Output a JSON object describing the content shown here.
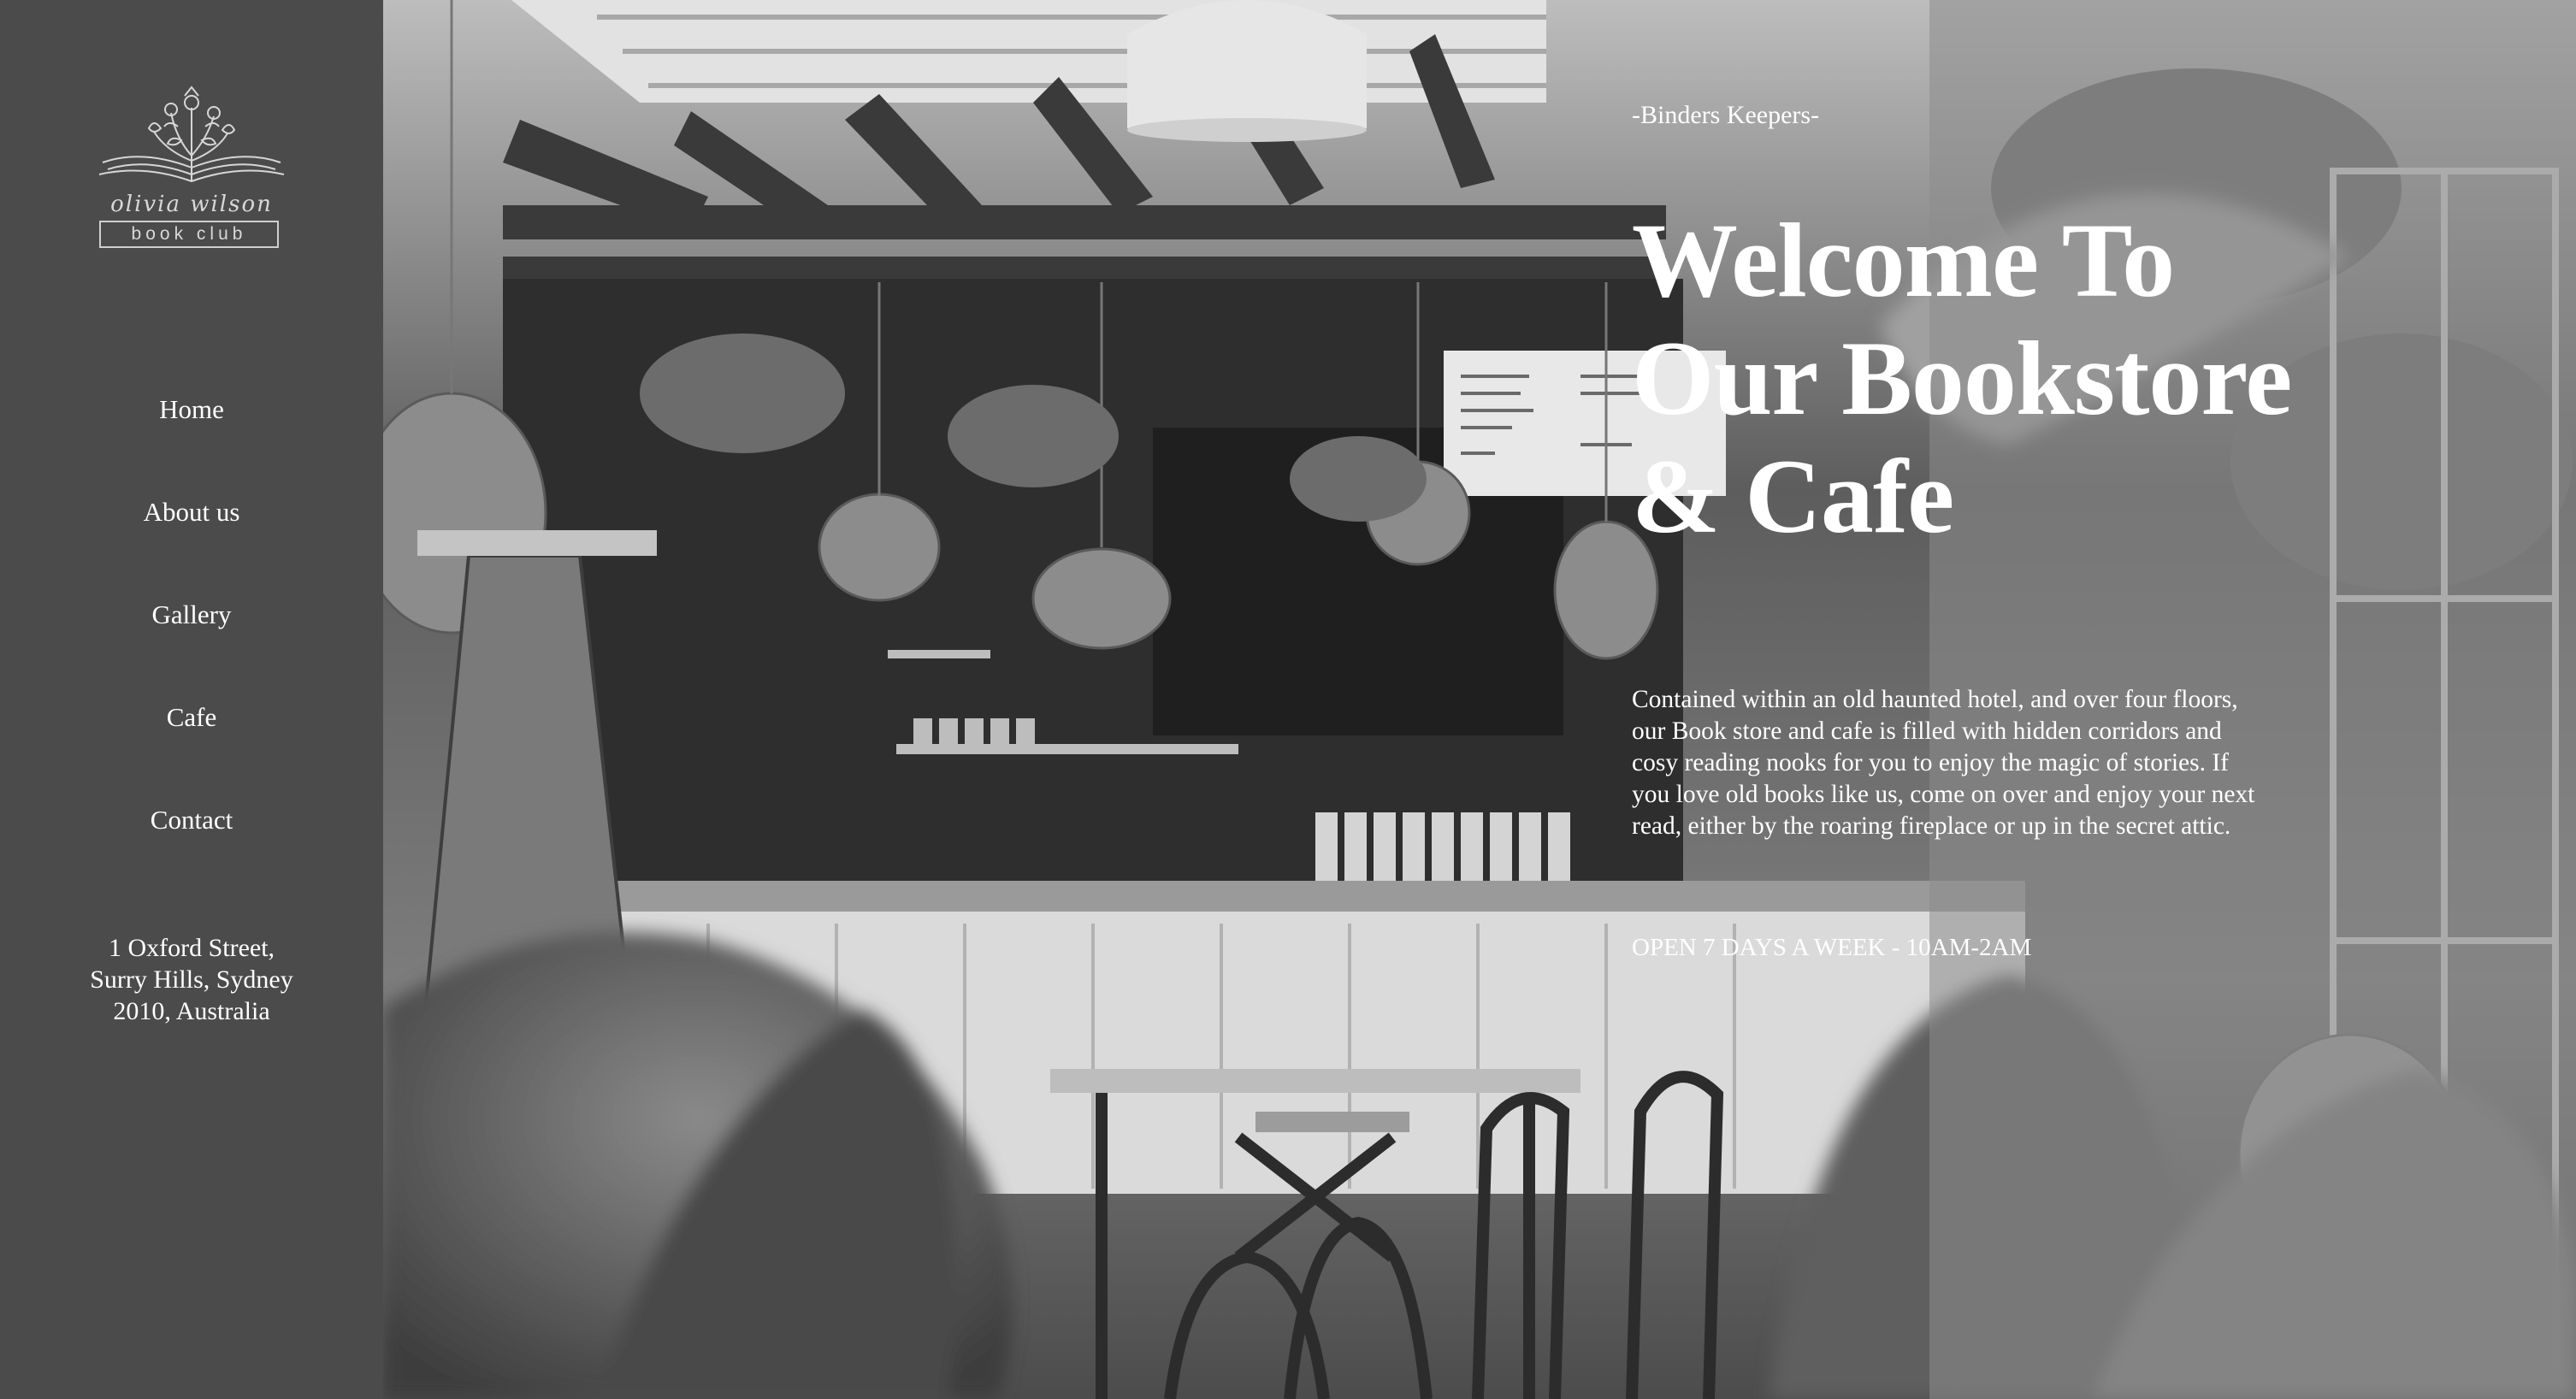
{
  "brand": {
    "name": "olivia wilson",
    "subtitle": "book club"
  },
  "nav": {
    "items": [
      {
        "label": "Home"
      },
      {
        "label": "About us"
      },
      {
        "label": "Gallery"
      },
      {
        "label": "Cafe"
      },
      {
        "label": "Contact"
      }
    ]
  },
  "address": {
    "line1": "1 Oxford Street,",
    "line2": "Surry Hills, Sydney",
    "line3": "2010, Australia"
  },
  "hero": {
    "tagline": "-Binders Keepers-",
    "headline": {
      "line1": "Welcome To",
      "line2": "Our Bookstore",
      "line3": "& Cafe"
    },
    "description": "Contained within an old haunted hotel, and over four floors, our Book store and cafe is filled with hidden corridors and cosy reading nooks for you to enjoy the magic of stories. If you love old books like us, come on over and enjoy your next read, either by the roaring fireplace or up in the secret attic.",
    "hours": "OPEN 7 DAYS A WEEK - 10AM-2AM"
  },
  "colors": {
    "sidebar_bg": "#4b4b4b",
    "text": "#ffffff",
    "overlay": "#8c8c8c"
  },
  "icons": {
    "logo": "open-book-with-flowers-icon"
  }
}
